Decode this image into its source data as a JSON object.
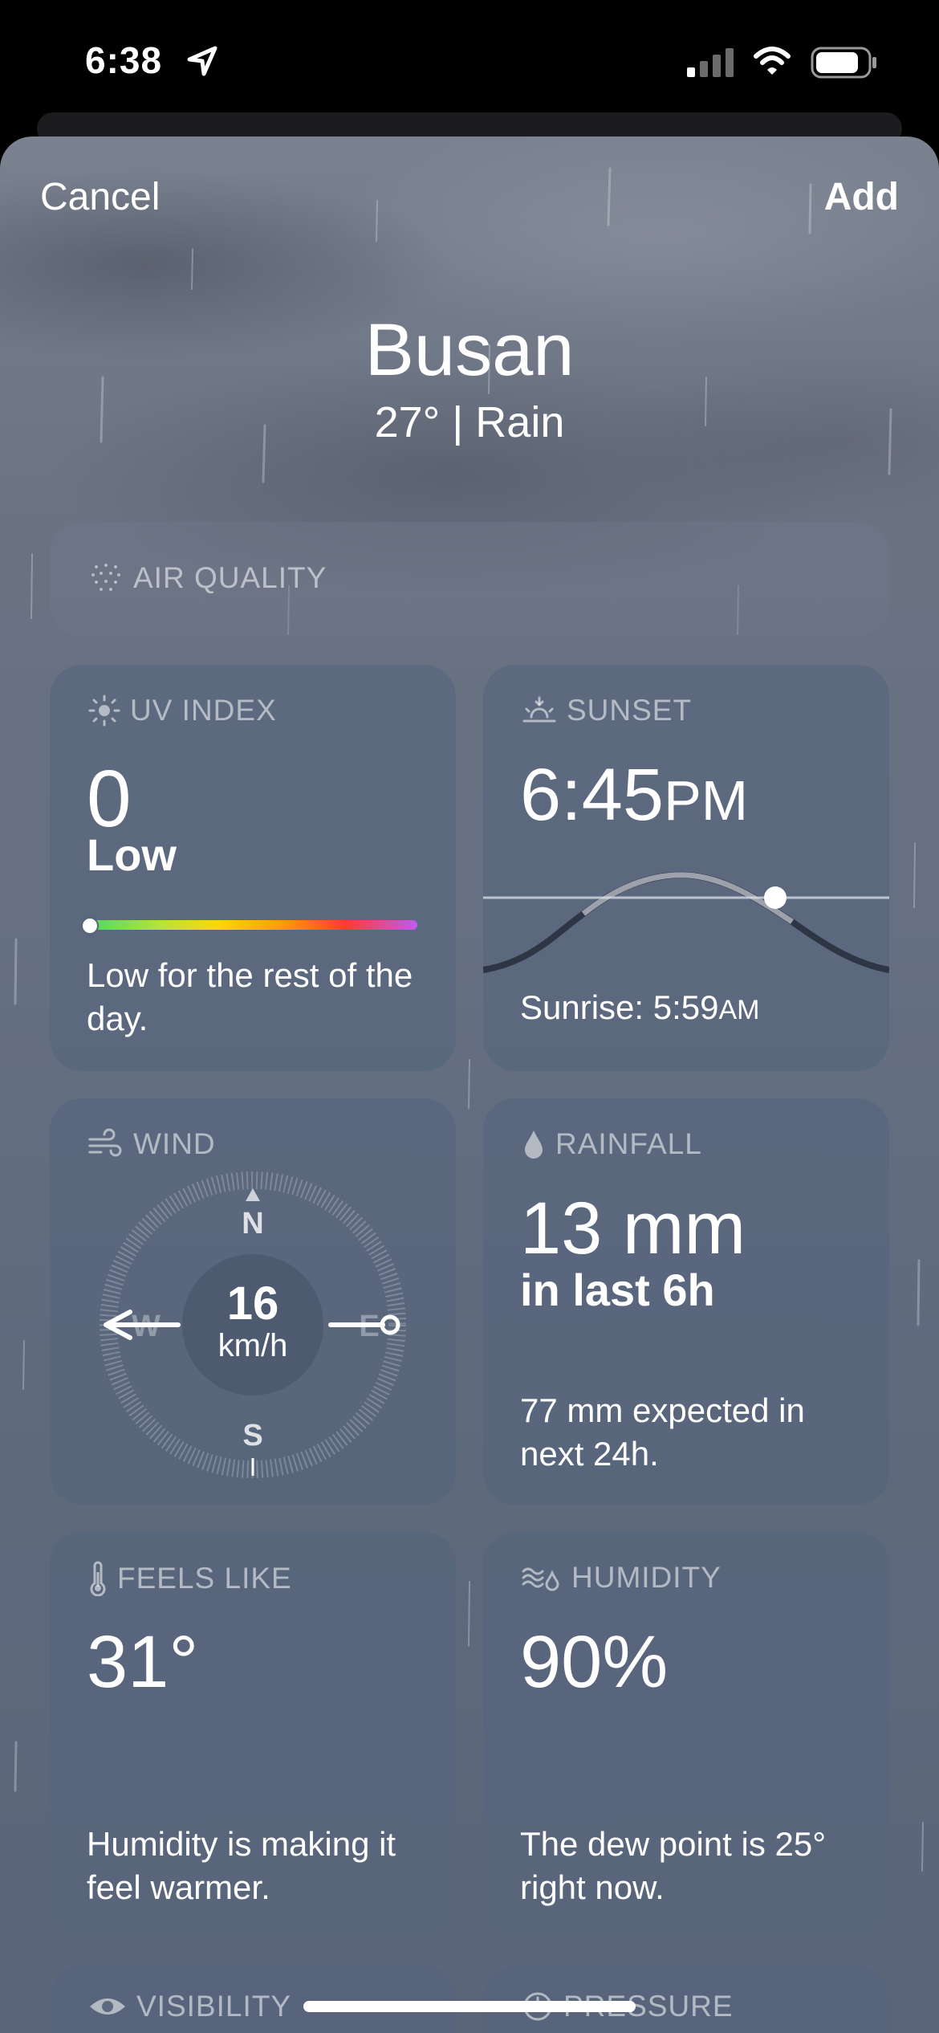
{
  "status_bar": {
    "time": "6:38"
  },
  "nav": {
    "cancel_label": "Cancel",
    "add_label": "Add"
  },
  "location": {
    "city": "Busan",
    "condition_line": "27°  |  Rain"
  },
  "air_quality": {
    "title": "AIR QUALITY"
  },
  "uv_index": {
    "title": "UV INDEX",
    "value": "0",
    "level": "Low",
    "description": "Low for the rest of the day.",
    "scale_position": 0.0
  },
  "sunset": {
    "title": "SUNSET",
    "time": "6:45",
    "meridiem": "PM",
    "sunrise_label": "Sunrise: 5:59",
    "sunrise_meridiem": "AM"
  },
  "wind": {
    "title": "WIND",
    "speed": "16",
    "unit": "km/h",
    "directions": {
      "n": "N",
      "s": "S",
      "e": "E",
      "w": "W"
    }
  },
  "rainfall": {
    "title": "RAINFALL",
    "amount": "13 mm",
    "period": "in last 6h",
    "forecast": "77 mm expected in next 24h."
  },
  "feels_like": {
    "title": "FEELS LIKE",
    "value": "31°",
    "description": "Humidity is making it feel warmer."
  },
  "humidity": {
    "title": "HUMIDITY",
    "value": "90%",
    "description": "The dew point is 25° right now."
  },
  "visibility": {
    "title": "VISIBILITY"
  },
  "pressure": {
    "title": "PRESSURE"
  },
  "colors": {
    "sheet": "#667082",
    "card": "#56647c",
    "uv_low": "#4cd964",
    "uv_extreme": "#bf5af2"
  }
}
